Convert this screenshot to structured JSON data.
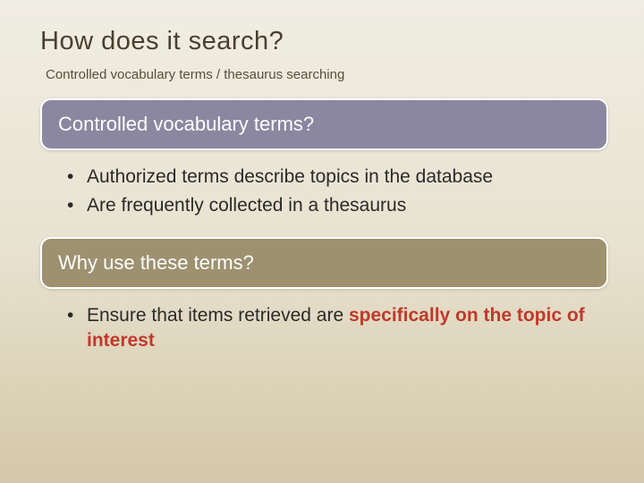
{
  "title": "How does it search?",
  "subtitle": "Controlled vocabulary terms / thesaurus searching",
  "sections": [
    {
      "header": "Controlled vocabulary terms?",
      "bullets": [
        "Authorized terms describe topics in the database",
        "Are frequently collected in a thesaurus"
      ]
    },
    {
      "header": "Why use these terms?",
      "bullets_prefix": "Ensure that items retrieved are ",
      "bullets_emph": "specifically on the topic of interest"
    }
  ],
  "colors": {
    "header1_bg": "#8c87a0",
    "header2_bg": "#9d9170",
    "emph": "#c0392b"
  }
}
